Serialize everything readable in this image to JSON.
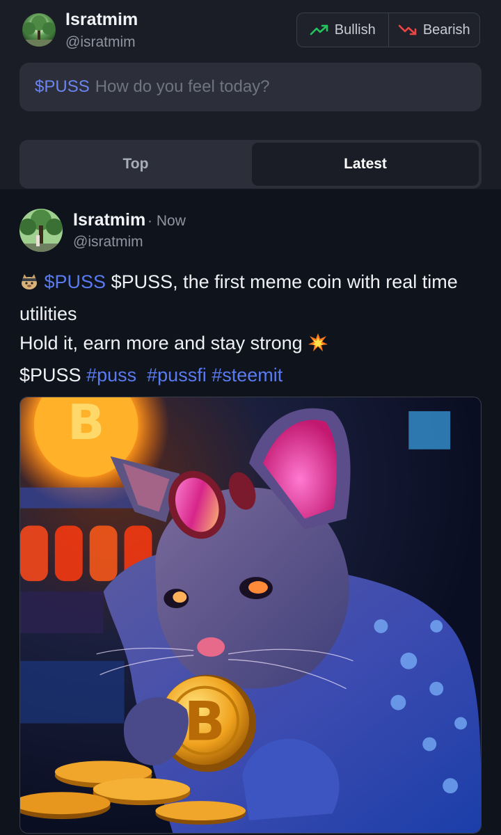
{
  "composer": {
    "user": {
      "name": "Isratmim",
      "handle": "@isratmim"
    },
    "sentiment": {
      "bullish_label": "Bullish",
      "bearish_label": "Bearish",
      "bullish_color": "#22c55e",
      "bearish_color": "#ef4444"
    },
    "input": {
      "ticker": "$PUSS",
      "placeholder": "How do you feel today?"
    },
    "tabs": [
      {
        "label": "Top",
        "active": false
      },
      {
        "label": "Latest",
        "active": true
      }
    ]
  },
  "post": {
    "author": {
      "name": "Isratmim",
      "handle": "@isratmim"
    },
    "time_sep": "·",
    "time": "Now",
    "body": {
      "ticker_link": "$PUSS",
      "text1": "$PUSS, the first meme coin with real time utilities",
      "text2": "Hold it, earn more and stay strong",
      "ticker_plain": "$PUSS",
      "hashtags": [
        "#puss",
        "#pussfi",
        "#steemit"
      ]
    },
    "image_alt": "Neon cat with goggles holding a bitcoin coin",
    "image_text": "B"
  },
  "colors": {
    "accent": "#5a7bf0",
    "background": "#0f131c",
    "panel": "#2c2f39"
  }
}
